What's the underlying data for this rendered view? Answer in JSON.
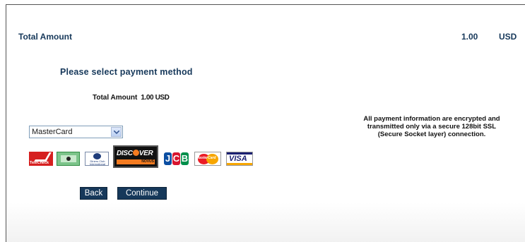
{
  "header": {
    "total_label": "Total Amount",
    "total_value": "1.00",
    "currency": "USD"
  },
  "main": {
    "title": "Please select payment method",
    "summary_label": "Total Amount",
    "summary_amount": "1.00 USD",
    "payment_select": {
      "selected": "MasterCard"
    },
    "security_note": "All payment information are encrypted and transmitted only via a secure 128bit SSL (Secure Socket layer) connection.",
    "cards": [
      {
        "icon": "telecheck-icon",
        "label": "TeleCheck"
      },
      {
        "icon": "echeck-icon",
        "label": ""
      },
      {
        "icon": "diners-club-icon",
        "label": "Diners Club International"
      },
      {
        "icon": "discover-icon",
        "label": "DISCOVER",
        "sub": "NOVUS"
      },
      {
        "icon": "jcb-icon",
        "label": "JCB"
      },
      {
        "icon": "mastercard-icon",
        "label": "MasterCard"
      },
      {
        "icon": "visa-icon",
        "label": "VISA"
      }
    ],
    "buttons": {
      "back": "Back",
      "continue": "Continue"
    }
  },
  "colors": {
    "heading": "#16385a",
    "button_bg": "#16385a",
    "button_text": "#ffffff"
  }
}
